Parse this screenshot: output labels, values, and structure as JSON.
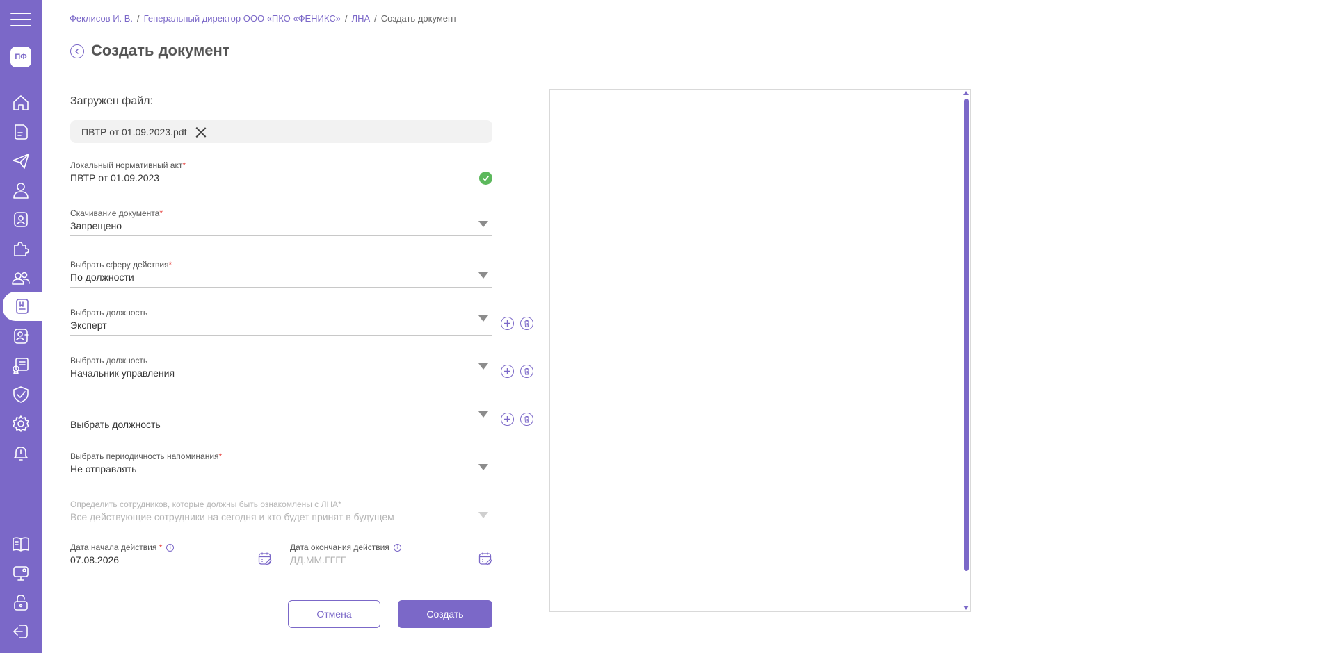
{
  "sidebar": {
    "logo_text": "ПФ",
    "icons": [
      "home-icon",
      "document-icon",
      "send-icon",
      "user-icon",
      "badge-icon",
      "puzzle-icon",
      "users-icon",
      "lna-icon",
      "contact-icon",
      "certificate-icon",
      "shield-icon",
      "settings-icon",
      "bell-icon",
      "book-icon",
      "monitor-icon",
      "unlock-icon",
      "logout-icon"
    ],
    "active": "lna-icon",
    "accent_color": "#7b68c8"
  },
  "breadcrumbs": {
    "items": [
      "Феклисов И. В.",
      "Генеральный директор ООО «ПКО «ФЕНИКС»",
      "ЛНА"
    ],
    "current": "Создать документ",
    "separator": "/"
  },
  "page": {
    "title": "Создать документ"
  },
  "upload": {
    "label": "Загружен файл:",
    "file_name": "ПВТР от 01.09.2023.pdf"
  },
  "fields": {
    "lna": {
      "label": "Локальный нормативный акт",
      "value": "ПВТР от 01.09.2023",
      "required": "*"
    },
    "download": {
      "label": "Скачивание документа",
      "value": "Запрещено",
      "required": "*"
    },
    "scope": {
      "label": "Выбрать сферу действия",
      "value": "По должности",
      "required": "*"
    },
    "position1": {
      "label": "Выбрать должность",
      "value": "Эксперт"
    },
    "position2": {
      "label": "Выбрать должность",
      "value": "Начальник управления"
    },
    "position3": {
      "placeholder": "Выбрать должность"
    },
    "reminder": {
      "label": "Выбрать периодичность напоминания",
      "value": "Не отправлять",
      "required": "*"
    },
    "employees": {
      "label": "Определить сотрудников, которые должны быть ознакомлены с ЛНА*",
      "value": "Все действующие сотрудники на сегодня и кто будет принят в будущем"
    },
    "start_date": {
      "label": "Дата начала действия",
      "required": "*",
      "value": "07.08.2026"
    },
    "end_date": {
      "label": "Дата окончания действия",
      "placeholder": "ДД.ММ.ГГГГ"
    }
  },
  "buttons": {
    "cancel": "Отмена",
    "create": "Создать"
  }
}
